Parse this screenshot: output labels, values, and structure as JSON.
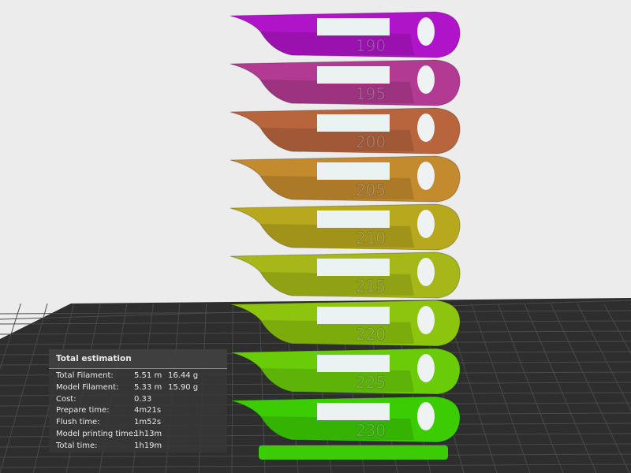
{
  "scene": {
    "model_name": "temperature tower",
    "tier_labels": [
      "190",
      "195",
      "200",
      "205",
      "210",
      "215",
      "220",
      "225",
      "230"
    ],
    "tier_colors": [
      "#b014c8",
      "#b23a92",
      "#b8653e",
      "#c38a2e",
      "#b8a81e",
      "#a6b817",
      "#8cc40e",
      "#6acc08",
      "#3ccc04"
    ],
    "background_color": "#ececec",
    "plate_color": "#2e2e2e"
  },
  "estimation": {
    "title": "Total estimation",
    "rows": [
      {
        "label": "Total Filament:",
        "value": "5.51 m",
        "value2": "16.44 g"
      },
      {
        "label": "Model Filament:",
        "value": "5.33 m",
        "value2": "15.90 g"
      },
      {
        "label": "Cost:",
        "value": "0.33",
        "value2": ""
      },
      {
        "label": "Prepare time:",
        "value": "4m21s",
        "value2": ""
      },
      {
        "label": "Flush time:",
        "value": "1m52s",
        "value2": ""
      },
      {
        "label": "Model printing time:",
        "value": "1h13m",
        "value2": ""
      },
      {
        "label": "Total time:",
        "value": "1h19m",
        "value2": ""
      }
    ]
  }
}
